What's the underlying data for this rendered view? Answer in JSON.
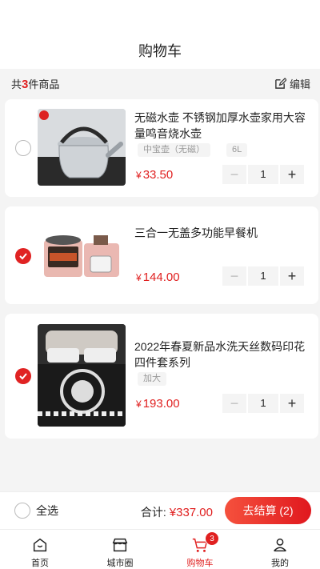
{
  "header": {
    "title": "购物车"
  },
  "summary": {
    "prefix": "共",
    "count": "3",
    "suffix": "件商品",
    "edit_label": "编辑"
  },
  "items": [
    {
      "title": "无磁水壶 不锈钢加厚水壶家用大容量鸣音烧水壶",
      "specs": [
        "中宝壶（无磁）",
        "6L"
      ],
      "currency": "¥",
      "price": "33.50",
      "quantity": "1",
      "checked": false
    },
    {
      "title": "三合一无盖多功能早餐机",
      "specs": [],
      "currency": "¥",
      "price": "144.00",
      "quantity": "1",
      "checked": true
    },
    {
      "title": "2022年春夏新品水洗天丝数码印花四件套系列",
      "specs": [
        "加大"
      ],
      "currency": "¥",
      "price": "193.00",
      "quantity": "1",
      "checked": true
    }
  ],
  "checkout": {
    "select_all_label": "全选",
    "total_label": "合计:",
    "currency": "¥",
    "total": "337.00",
    "button_label": "去结算 (2)"
  },
  "tabbar": {
    "tabs": [
      {
        "label": "首页",
        "icon": "home-icon"
      },
      {
        "label": "城市圈",
        "icon": "store-icon"
      },
      {
        "label": "购物车",
        "icon": "cart-icon",
        "badge": "3",
        "active": true
      },
      {
        "label": "我的",
        "icon": "user-icon"
      }
    ]
  },
  "colors": {
    "accent": "#e02020",
    "background": "#f4f4f4"
  }
}
